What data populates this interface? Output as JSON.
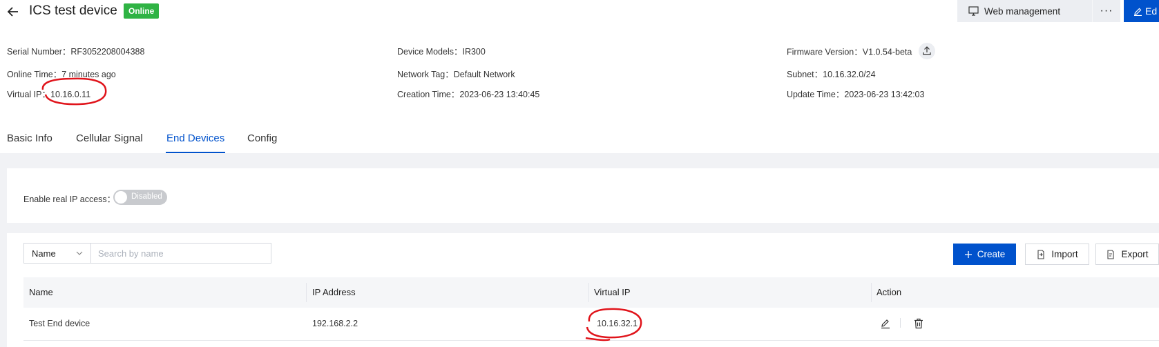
{
  "header": {
    "title": "ICS test device",
    "status_badge": "Online",
    "web_management_label": "Web management",
    "more_label": "···",
    "edit_label": "Ed"
  },
  "info": {
    "serial_number": {
      "key": "Serial Number：",
      "value": "RF3052208004388"
    },
    "online_time": {
      "key": "Online Time：",
      "value": "7 minutes ago"
    },
    "virtual_ip": {
      "key": "Virtual IP：",
      "value": "10.16.0.11"
    },
    "device_models": {
      "key": "Device Models：",
      "value": "IR300"
    },
    "network_tag": {
      "key": "Network Tag：",
      "value": "Default Network"
    },
    "creation_time": {
      "key": "Creation Time：",
      "value": "2023-06-23 13:40:45"
    },
    "firmware_version": {
      "key": "Firmware Version：",
      "value": "V1.0.54-beta"
    },
    "subnet": {
      "key": "Subnet：",
      "value": "10.16.32.0/24"
    },
    "update_time": {
      "key": "Update Time：",
      "value": "2023-06-23 13:42:03"
    }
  },
  "tabs": {
    "basic_info": "Basic Info",
    "cellular_signal": "Cellular Signal",
    "end_devices": "End Devices",
    "config": "Config",
    "active": "End Devices"
  },
  "real_ip": {
    "label": "Enable real IP access：",
    "toggle_text": "Disabled",
    "enabled": false
  },
  "filter": {
    "field_selected": "Name",
    "search_placeholder": "Search by name"
  },
  "toolbar": {
    "create_label": "Create",
    "import_label": "Import",
    "export_label": "Export"
  },
  "table": {
    "columns": [
      "Name",
      "IP Address",
      "Virtual IP",
      "Action"
    ],
    "rows": [
      {
        "name": "Test End device",
        "ip_address": "192.168.2.2",
        "virtual_ip": "10.16.32.1"
      }
    ]
  },
  "colors": {
    "primary": "#0052cc",
    "online": "#2fb344",
    "annotation": "#e0141b"
  }
}
